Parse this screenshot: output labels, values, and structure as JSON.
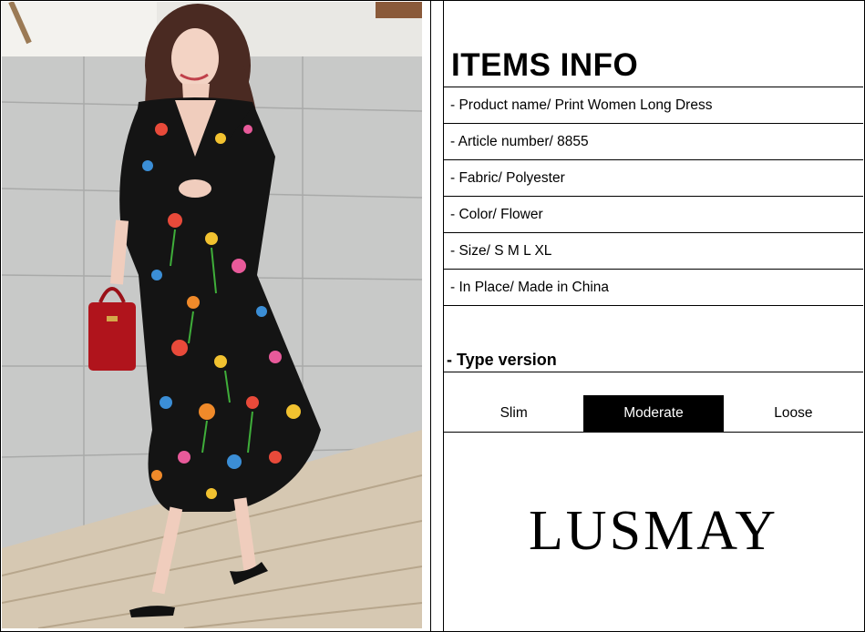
{
  "colors": {
    "border": "#000000",
    "background": "#ffffff",
    "active_tab_bg": "#000000",
    "active_tab_text": "#ffffff"
  },
  "items_info": {
    "title": "ITEMS INFO",
    "rows": [
      "- Product name/ Print Women Long Dress",
      "- Article number/ 8855",
      "- Fabric/ Polyester",
      "- Color/ Flower",
      "- Size/ S M L XL",
      "- In Place/ Made in China"
    ]
  },
  "type_version": {
    "label": "- Type version",
    "options": [
      "Slim",
      "Moderate",
      "Loose"
    ],
    "selected": "Moderate"
  },
  "brand": {
    "logo_text": "LUSMAY"
  }
}
